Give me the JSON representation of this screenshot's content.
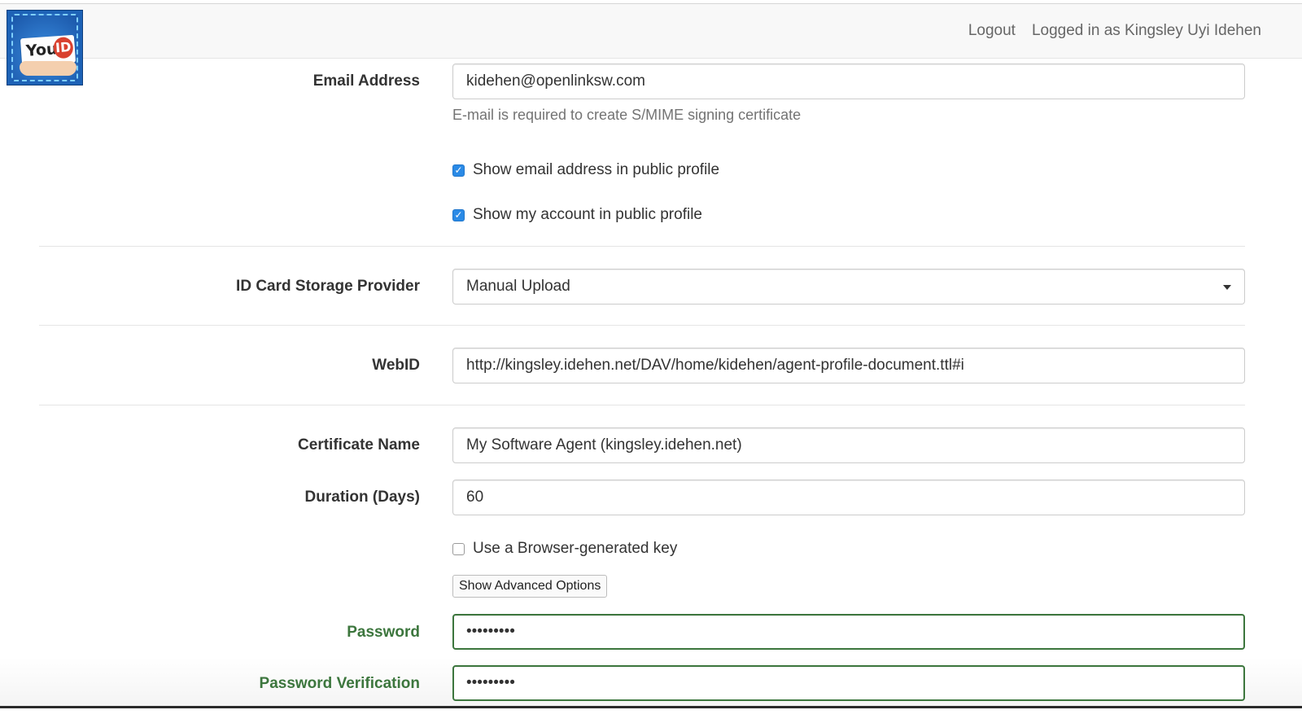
{
  "header": {
    "logo": {
      "text_you": "You",
      "text_id": "ID"
    },
    "logout_label": "Logout",
    "logged_in_text": "Logged in as Kingsley Uyi Idehen"
  },
  "form": {
    "email": {
      "label": "Email Address",
      "value": "kidehen@openlinksw.com",
      "help": "E-mail is required to create S/MIME signing certificate"
    },
    "show_email": {
      "label": "Show email address in public profile",
      "checked": true
    },
    "show_account": {
      "label": "Show my account in public profile",
      "checked": true
    },
    "storage_provider": {
      "label": "ID Card Storage Provider",
      "selected": "Manual Upload"
    },
    "webid": {
      "label": "WebID",
      "value": "http://kingsley.idehen.net/DAV/home/kidehen/agent-profile-document.ttl#i"
    },
    "certificate_name": {
      "label": "Certificate Name",
      "value": "My Software Agent (kingsley.idehen.net)"
    },
    "duration": {
      "label": "Duration (Days)",
      "value": "60"
    },
    "browser_key": {
      "label": "Use a Browser-generated key",
      "checked": false
    },
    "advanced_button": "Show Advanced Options",
    "password": {
      "label": "Password",
      "value": "•••••••••"
    },
    "password_verification": {
      "label": "Password Verification",
      "value": "•••••••••"
    }
  },
  "colors": {
    "success": "#3c763d",
    "checkbox": "#2a8ae6",
    "navbar_bg": "#f8f8f8"
  }
}
